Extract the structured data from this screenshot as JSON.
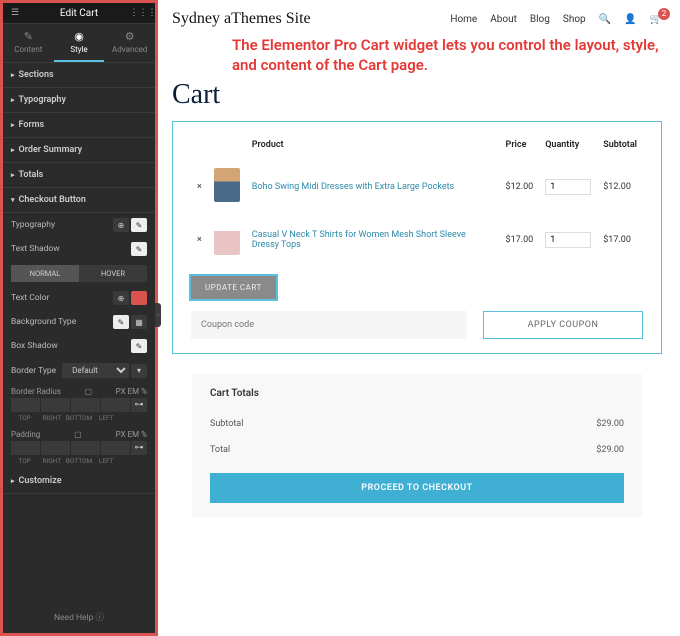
{
  "sidebar": {
    "title": "Edit Cart",
    "tabs": {
      "content": "Content",
      "style": "Style",
      "advanced": "Advanced"
    },
    "sections": {
      "sections": "Sections",
      "typography": "Typography",
      "forms": "Forms",
      "order_summary": "Order Summary",
      "totals": "Totals",
      "checkout_button": "Checkout Button",
      "customize": "Customize"
    },
    "rows": {
      "typography": "Typography",
      "text_shadow": "Text Shadow",
      "text_color": "Text Color",
      "background_type": "Background Type",
      "box_shadow": "Box Shadow",
      "border_type": "Border Type",
      "border_radius": "Border Radius",
      "padding": "Padding"
    },
    "toggle": {
      "normal": "NORMAL",
      "hover": "HOVER"
    },
    "border_default": "Default",
    "dim_labels": {
      "top": "TOP",
      "right": "RIGHT",
      "bottom": "BOTTOM",
      "left": "LEFT"
    },
    "units": {
      "px": "PX",
      "em": "EM",
      "pct": "%"
    },
    "footer": "Need Help"
  },
  "header": {
    "site_title": "Sydney aThemes Site",
    "nav": {
      "home": "Home",
      "about": "About",
      "blog": "Blog",
      "shop": "Shop"
    },
    "cart_count": "2"
  },
  "callout": "The Elementor Pro Cart widget lets you control the layout, style, and content of the Cart page.",
  "page_title": "Cart",
  "cart": {
    "headers": {
      "product": "Product",
      "price": "Price",
      "quantity": "Quantity",
      "subtotal": "Subtotal"
    },
    "items": [
      {
        "name": "Boho Swing Midi Dresses with Extra Large Pockets",
        "price": "$12.00",
        "qty": "1",
        "subtotal": "$12.00"
      },
      {
        "name": "Casual V Neck T Shirts for Women Mesh Short Sleeve Dressy Tops",
        "price": "$17.00",
        "qty": "1",
        "subtotal": "$17.00"
      }
    ],
    "update_btn": "UPDATE CART",
    "coupon_placeholder": "Coupon code",
    "apply_btn": "APPLY COUPON"
  },
  "totals": {
    "title": "Cart Totals",
    "subtotal_label": "Subtotal",
    "subtotal_value": "$29.00",
    "total_label": "Total",
    "total_value": "$29.00",
    "checkout_btn": "PROCEED TO CHECKOUT"
  }
}
